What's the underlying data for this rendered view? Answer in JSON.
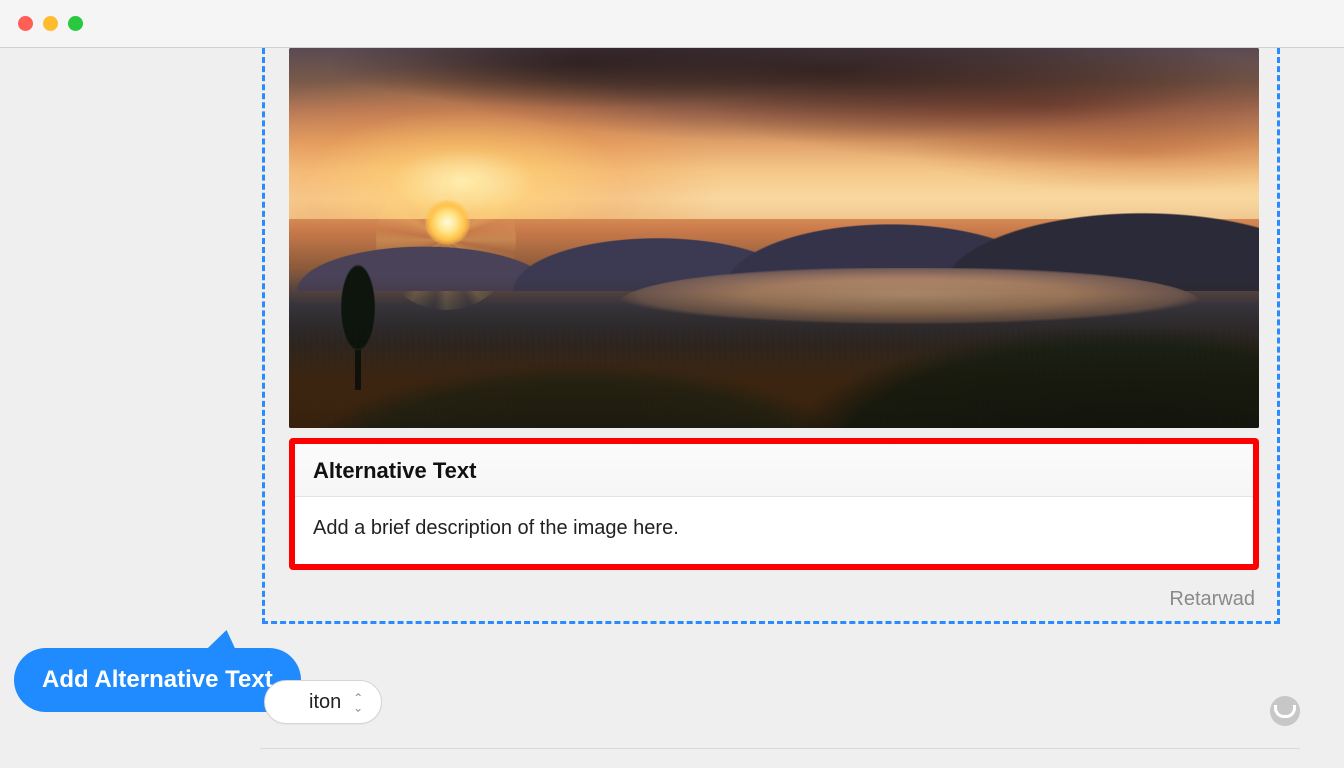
{
  "window": {
    "traffic_lights": {
      "red": "#ff5f57",
      "yellow": "#febc2e",
      "green": "#28c840"
    }
  },
  "alt_text_panel": {
    "title": "Alternative Text",
    "placeholder": "Add a brief description of the image here."
  },
  "credit": "Retarwad",
  "callout": {
    "label": "Add Alternative Text"
  },
  "secondary_button": {
    "label_fragment": "iton"
  },
  "colors": {
    "selection_border": "#2a8bff",
    "highlight_border": "#ff0000",
    "callout_bg": "#1f8bff"
  }
}
